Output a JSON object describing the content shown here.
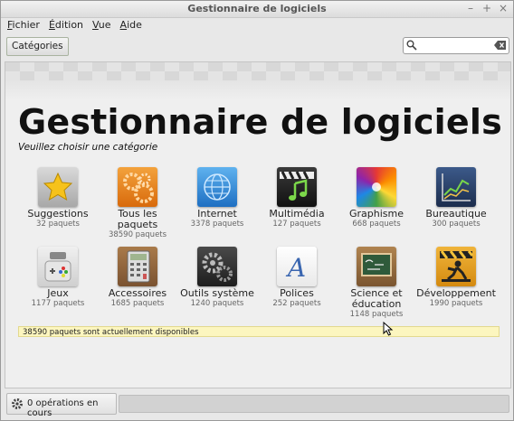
{
  "window": {
    "title": "Gestionnaire de logiciels",
    "buttons": [
      "–",
      "+",
      "×"
    ]
  },
  "menu": [
    {
      "u": "F",
      "rest": "ichier"
    },
    {
      "u": "É",
      "rest": "dition"
    },
    {
      "u": "V",
      "rest": "ue"
    },
    {
      "u": "A",
      "rest": "ide"
    }
  ],
  "toolbar": {
    "categories_label": "Catégories",
    "search_value": ""
  },
  "main": {
    "title": "Gestionnaire de logiciels",
    "subtitle": "Veuillez choisir une catégorie",
    "categories": [
      {
        "name": "Suggestions",
        "count": "32 paquets",
        "icon": "star-icon"
      },
      {
        "name": "Tous les paquets",
        "count": "38590 paquets",
        "icon": "gears-icon"
      },
      {
        "name": "Internet",
        "count": "3378 paquets",
        "icon": "globe-icon"
      },
      {
        "name": "Multimédia",
        "count": "127 paquets",
        "icon": "media-icon"
      },
      {
        "name": "Graphisme",
        "count": "668 paquets",
        "icon": "palette-icon"
      },
      {
        "name": "Bureautique",
        "count": "300 paquets",
        "icon": "chart-icon"
      },
      {
        "name": "Jeux",
        "count": "1177 paquets",
        "icon": "gamepad-icon"
      },
      {
        "name": "Accessoires",
        "count": "1685 paquets",
        "icon": "calculator-icon"
      },
      {
        "name": "Outils système",
        "count": "1240 paquets",
        "icon": "system-gears-icon"
      },
      {
        "name": "Polices",
        "count": "252 paquets",
        "icon": "font-icon"
      },
      {
        "name": "Science et éducation",
        "count": "1148 paquets",
        "icon": "blackboard-icon"
      },
      {
        "name": "Développement",
        "count": "1990 paquets",
        "icon": "construction-icon"
      }
    ],
    "status": "38590 paquets sont actuellement disponibles"
  },
  "footer": {
    "operations": "0 opérations en cours"
  },
  "colors": {
    "status_bg": "#fcf6bf"
  }
}
